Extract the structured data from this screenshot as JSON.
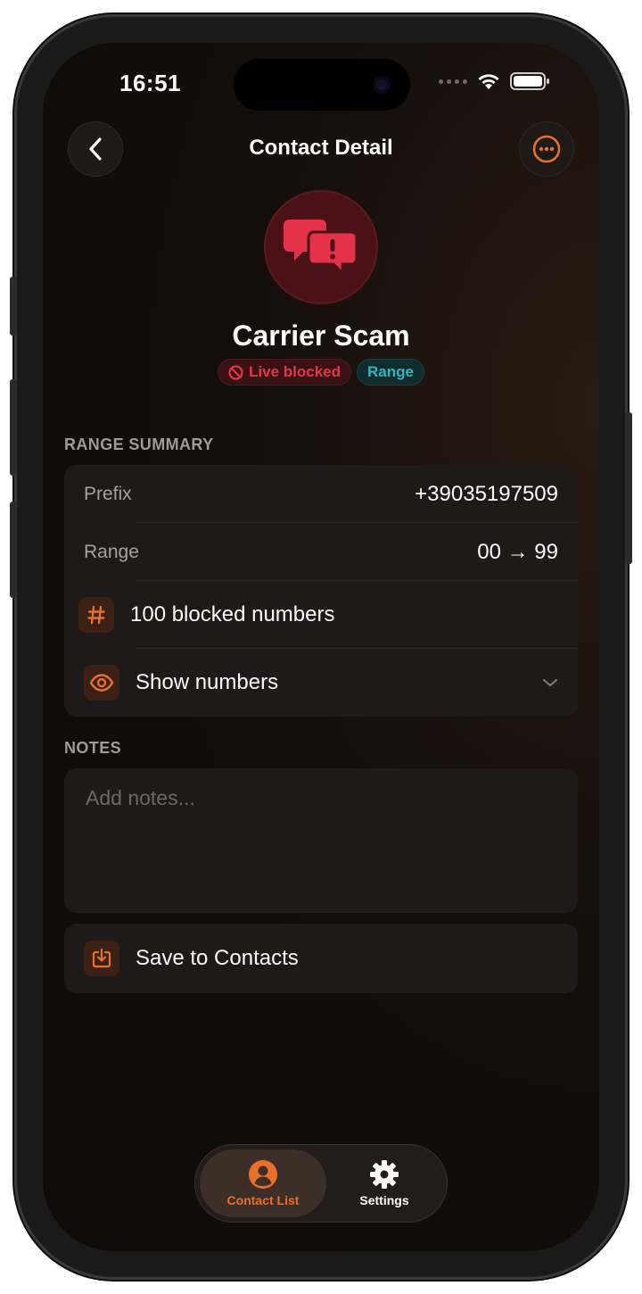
{
  "status_bar": {
    "time": "16:51"
  },
  "header": {
    "title": "Contact Detail"
  },
  "contact": {
    "name": "Carrier Scam",
    "badges": {
      "blocked": "Live blocked",
      "range": "Range"
    }
  },
  "range_summary": {
    "section_label": "RANGE SUMMARY",
    "prefix_label": "Prefix",
    "prefix_value": "+39035197509",
    "range_label": "Range",
    "range_value": "00 → 99",
    "blocked_count_text": "100 blocked numbers",
    "show_numbers_label": "Show numbers"
  },
  "notes": {
    "section_label": "NOTES",
    "placeholder": "Add notes..."
  },
  "actions": {
    "save_label": "Save to Contacts"
  },
  "tabbar": {
    "tabs": [
      {
        "label": "Contact List",
        "active": true,
        "icon": "person-circle-icon"
      },
      {
        "label": "Settings",
        "active": false,
        "icon": "gear-icon"
      }
    ]
  },
  "colors": {
    "accent": "#e8702a",
    "danger": "#e0384a",
    "teal": "#2cb8c0",
    "background": "#120d0b",
    "card": "#1d1a19"
  }
}
